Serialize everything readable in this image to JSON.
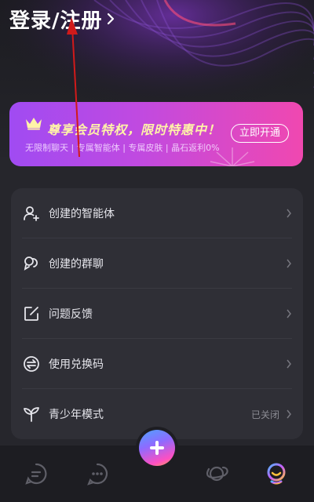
{
  "header": {
    "login_label": "登录/注册"
  },
  "vip_banner": {
    "title": "尊享会员特权，限时特惠中！",
    "subtitle": "无限制聊天 | 专属智能体 | 专属皮肤 | 晶石返利0%",
    "button_label": "立即开通"
  },
  "menu": {
    "items": [
      {
        "label": "创建的智能体",
        "icon": "add-user-icon",
        "value": ""
      },
      {
        "label": "创建的群聊",
        "icon": "group-chat-icon",
        "value": ""
      },
      {
        "label": "问题反馈",
        "icon": "feedback-edit-icon",
        "value": ""
      },
      {
        "label": "使用兑换码",
        "icon": "exchange-icon",
        "value": ""
      },
      {
        "label": "青少年模式",
        "icon": "sprout-icon",
        "value": "已关闭"
      }
    ]
  },
  "tabbar": {
    "tabs": [
      {
        "icon": "chat-bubble-icon"
      },
      {
        "icon": "message-dots-icon"
      },
      {
        "icon": "add-icon"
      },
      {
        "icon": "planet-icon"
      },
      {
        "icon": "profile-robot-icon"
      }
    ]
  },
  "colors": {
    "background": "#26262c",
    "card": "#2f2f36",
    "vip_gradient_start": "#a04bf2",
    "vip_gradient_end": "#f048b0",
    "vip_title": "#fff3a8",
    "annotation_arrow": "#d11a1a"
  }
}
